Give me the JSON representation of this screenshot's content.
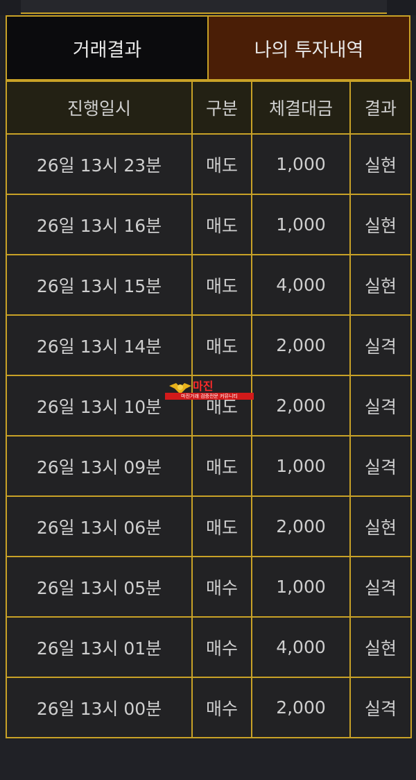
{
  "tabs": [
    {
      "label": "거래결과"
    },
    {
      "label": "나의 투자내역"
    }
  ],
  "table": {
    "headers": [
      "진행일시",
      "구분",
      "체결대금",
      "결과"
    ],
    "rows": [
      {
        "time": "26일 13시 23분",
        "type": "매도",
        "amount": "1,000",
        "result": "실현"
      },
      {
        "time": "26일 13시 16분",
        "type": "매도",
        "amount": "1,000",
        "result": "실현"
      },
      {
        "time": "26일 13시 15분",
        "type": "매도",
        "amount": "4,000",
        "result": "실현"
      },
      {
        "time": "26일 13시 14분",
        "type": "매도",
        "amount": "2,000",
        "result": "실격"
      },
      {
        "time": "26일 13시 10분",
        "type": "매도",
        "amount": "2,000",
        "result": "실격"
      },
      {
        "time": "26일 13시 09분",
        "type": "매도",
        "amount": "1,000",
        "result": "실격"
      },
      {
        "time": "26일 13시 06분",
        "type": "매도",
        "amount": "2,000",
        "result": "실현"
      },
      {
        "time": "26일 13시 05분",
        "type": "매수",
        "amount": "1,000",
        "result": "실격"
      },
      {
        "time": "26일 13시 01분",
        "type": "매수",
        "amount": "4,000",
        "result": "실현"
      },
      {
        "time": "26일 13시 00분",
        "type": "매수",
        "amount": "2,000",
        "result": "실격"
      }
    ]
  },
  "watermark": {
    "title": "마진",
    "subtitle": "마진거래 검증전문 커뮤니티"
  },
  "colors": {
    "accent_border": "#c9a227",
    "sell": "#44a9ea",
    "buy": "#ff6b6b",
    "tab_active": "#4a1e06"
  }
}
